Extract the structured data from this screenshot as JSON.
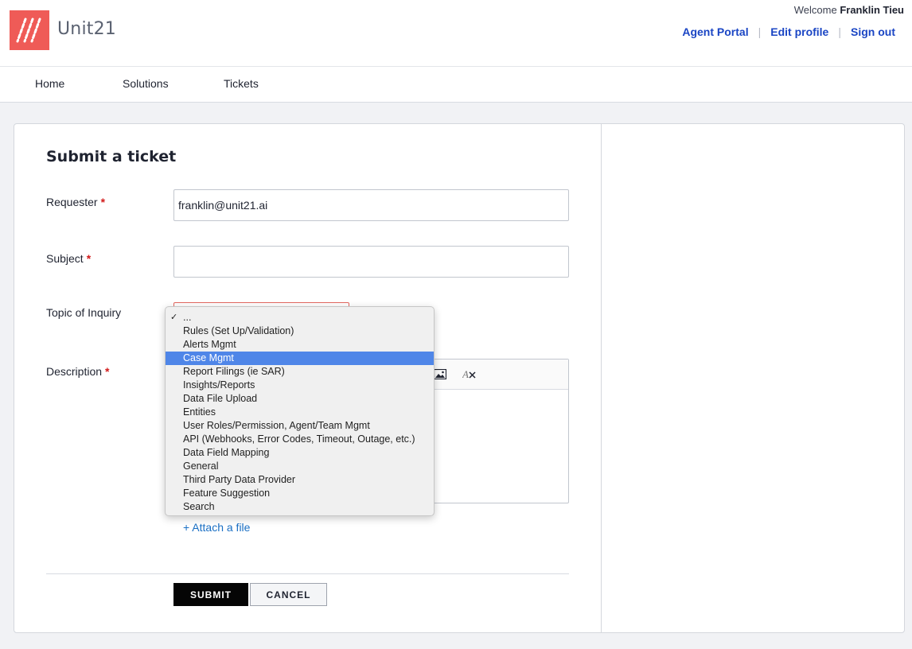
{
  "header": {
    "brand": "Unit21",
    "welcome_prefix": "Welcome",
    "user_name": "Franklin Tieu",
    "links": [
      "Agent Portal",
      "Edit profile",
      "Sign out"
    ],
    "separator": "|"
  },
  "nav": {
    "items": [
      "Home",
      "Solutions",
      "Tickets"
    ]
  },
  "form": {
    "title": "Submit a ticket",
    "required_mark": "*",
    "requester": {
      "label": "Requester",
      "value": "franklin@unit21.ai"
    },
    "subject": {
      "label": "Subject",
      "value": ""
    },
    "topic": {
      "label": "Topic of Inquiry",
      "selected": "...",
      "check_mark": "✓",
      "highlighted": "Case Mgmt",
      "options": [
        "...",
        "Rules (Set Up/Validation)",
        "Alerts Mgmt",
        "Case Mgmt",
        "Report Filings (ie SAR)",
        "Insights/Reports",
        "Data File Upload",
        "Entities",
        "User Roles/Permission, Agent/Team Mgmt",
        "API (Webhooks, Error Codes, Timeout, Outage, etc.)",
        "Data Field Mapping",
        "General",
        "Third Party Data Provider",
        "Feature Suggestion",
        "Search"
      ]
    },
    "description": {
      "label": "Description"
    },
    "editor_icons": [
      "image-icon",
      "clear-format-icon"
    ],
    "attach_label": "+ Attach a file",
    "submit_label": "SUBMIT",
    "cancel_label": "CANCEL"
  },
  "colors": {
    "brand": "#ef5b57",
    "link": "#1a45c4",
    "highlight": "#4f86e8",
    "required": "#d21a1a"
  }
}
